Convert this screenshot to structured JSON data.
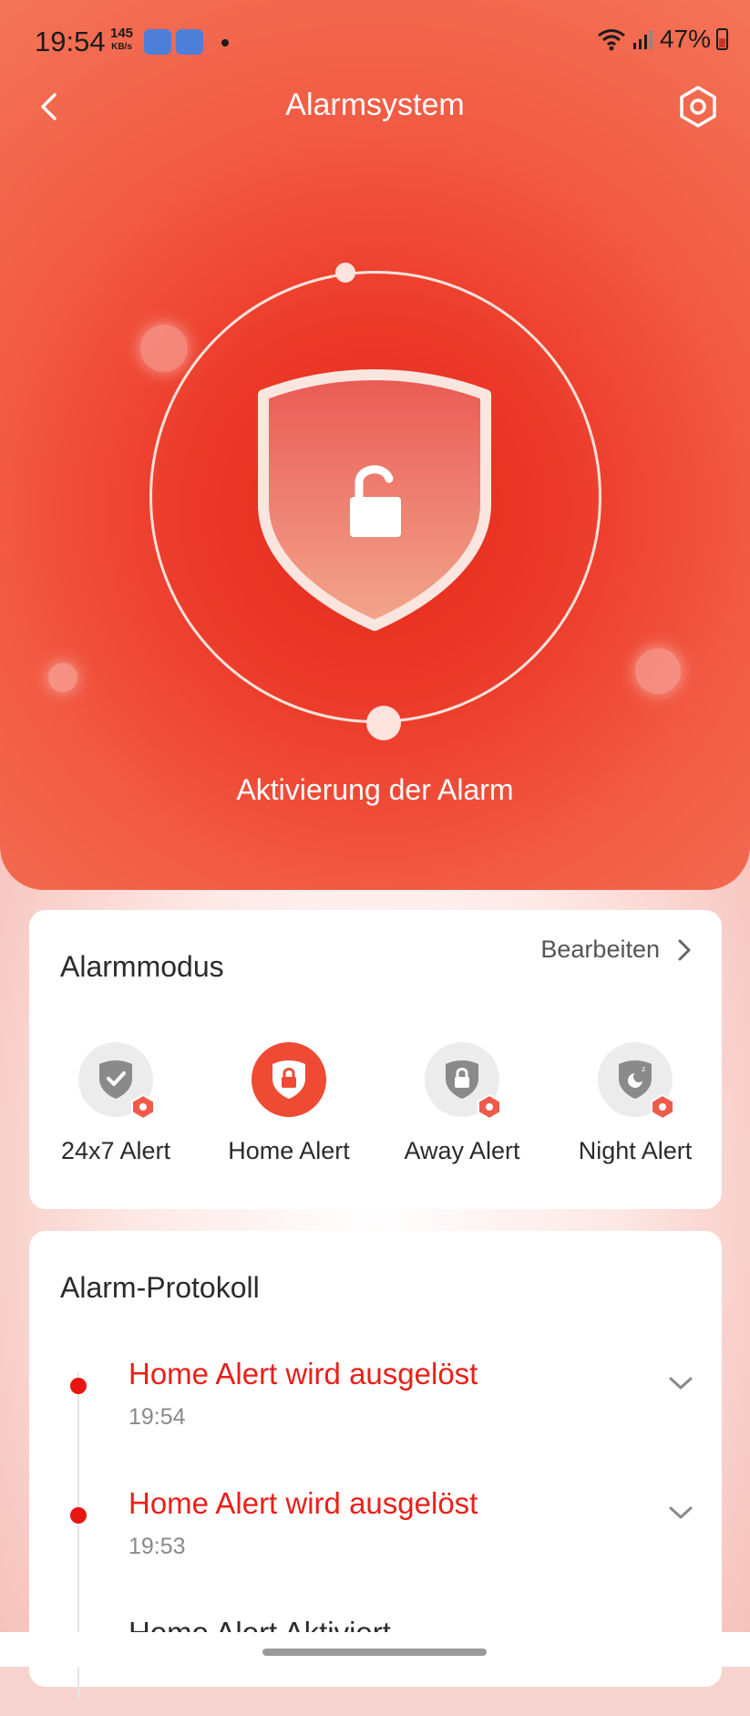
{
  "status_bar": {
    "time": "19:54",
    "net_speed_value": "145",
    "net_speed_unit": "KB/s",
    "battery": "47%"
  },
  "header": {
    "title": "Alarmsystem"
  },
  "hero": {
    "caption": "Aktivierung der Alarm"
  },
  "alarm_mode": {
    "title": "Alarmmodus",
    "edit_label": "Bearbeiten",
    "modes": [
      {
        "label": "24x7 Alert",
        "icon": "shield-check-icon",
        "active": false
      },
      {
        "label": "Home Alert",
        "icon": "shield-lock-icon",
        "active": true
      },
      {
        "label": "Away Alert",
        "icon": "shield-lock-icon",
        "active": false
      },
      {
        "label": "Night Alert",
        "icon": "shield-moon-icon",
        "active": false
      }
    ]
  },
  "alarm_log": {
    "title": "Alarm-Protokoll",
    "items": [
      {
        "title": "Home Alert wird ausgelöst",
        "time": "19:54"
      },
      {
        "title": "Home Alert wird ausgelöst",
        "time": "19:53"
      },
      {
        "title": "Home Alert Aktiviert",
        "time": ""
      }
    ]
  },
  "colors": {
    "accent": "#ef4a33",
    "alert_text": "#e8201a",
    "hero_center": "#e4281a"
  }
}
